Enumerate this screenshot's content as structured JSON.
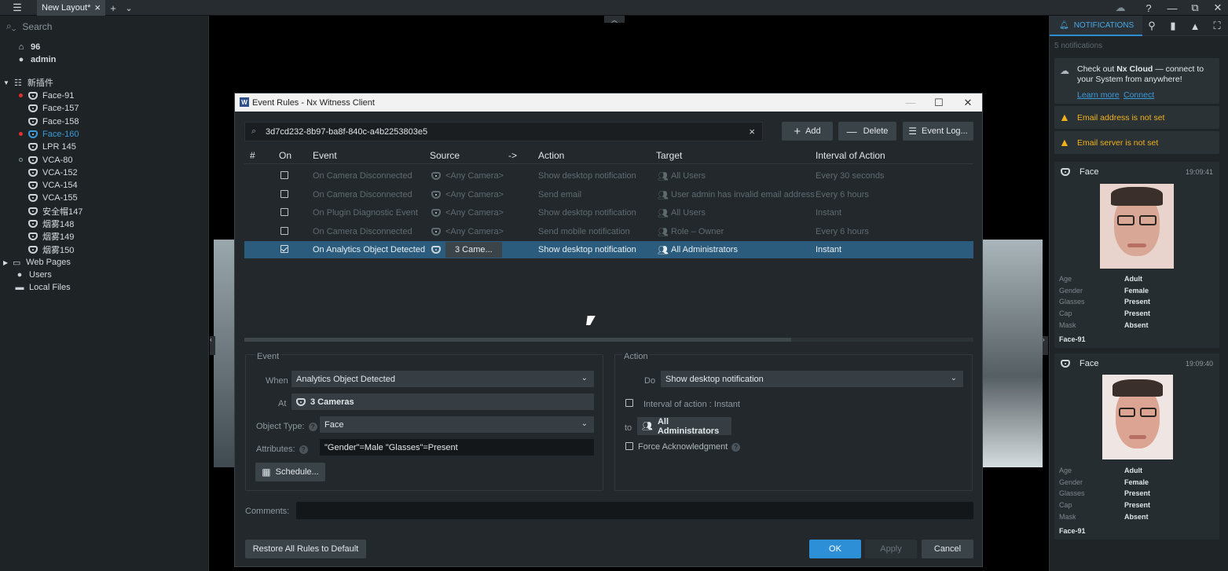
{
  "titlebar": {
    "tab_label": "New Layout*",
    "tab_close": "×",
    "add_tab": "+",
    "more": "⌄"
  },
  "window_controls": {
    "help": "?",
    "minimize": "—",
    "restore": "⧉",
    "close": "✕"
  },
  "left": {
    "search_placeholder": "Search",
    "server": "96",
    "user": "admin",
    "group": "新插件",
    "cameras": [
      {
        "name": "Face-91",
        "status": "red",
        "selected": false
      },
      {
        "name": "Face-157",
        "status": "none",
        "selected": false
      },
      {
        "name": "Face-158",
        "status": "none",
        "selected": false
      },
      {
        "name": "Face-160",
        "status": "red",
        "selected": true
      },
      {
        "name": "LPR 145",
        "status": "none",
        "selected": false
      },
      {
        "name": "VCA-80",
        "status": "hollow",
        "selected": false
      },
      {
        "name": "VCA-152",
        "status": "none",
        "selected": false
      },
      {
        "name": "VCA-154",
        "status": "none",
        "selected": false
      },
      {
        "name": "VCA-155",
        "status": "none",
        "selected": false
      },
      {
        "name": "安全帽147",
        "status": "none",
        "selected": false
      },
      {
        "name": "烟雾148",
        "status": "none",
        "selected": false
      },
      {
        "name": "烟雾149",
        "status": "none",
        "selected": false
      },
      {
        "name": "烟雾150",
        "status": "none",
        "selected": false
      }
    ],
    "web_pages": "Web Pages",
    "users": "Users",
    "local_files": "Local Files"
  },
  "right": {
    "tab_notifications": "NOTIFICATIONS",
    "count": "5 notifications",
    "cloud_text_1": "Check out ",
    "cloud_brand": "Nx Cloud",
    "cloud_text_2": " — connect to your System from anywhere!",
    "learn_more": "Learn more",
    "connect": "Connect",
    "warn_email_address": "Email address is not set",
    "warn_email_server": "Email server is not set",
    "cards": [
      {
        "title": "Face",
        "time": "19:09:41",
        "attrs": [
          [
            "Age",
            "Adult"
          ],
          [
            "Gender",
            "Female"
          ],
          [
            "Glasses",
            "Present"
          ],
          [
            "Cap",
            "Present"
          ],
          [
            "Mask",
            "Absent"
          ]
        ],
        "camera": "Face-91"
      },
      {
        "title": "Face",
        "time": "19:09:40",
        "attrs": [
          [
            "Age",
            "Adult"
          ],
          [
            "Gender",
            "Female"
          ],
          [
            "Glasses",
            "Present"
          ],
          [
            "Cap",
            "Present"
          ],
          [
            "Mask",
            "Absent"
          ]
        ],
        "camera": "Face-91"
      }
    ]
  },
  "dialog": {
    "title": "Event Rules - Nx Witness Client",
    "search_value": "3d7cd232-8b97-ba8f-840c-a4b2253803e5",
    "clear": "×",
    "add_label": "Add",
    "delete_label": "Delete",
    "event_log_label": "Event Log...",
    "columns": [
      "#",
      "On",
      "Event",
      "Source",
      "->",
      "Action",
      "Target",
      "Interval of Action"
    ],
    "rows": [
      {
        "event": "On Camera Disconnected",
        "source": "<Any Camera>",
        "action": "Show desktop notification",
        "target": "All Users",
        "interval": "Every 30 seconds",
        "selected": false
      },
      {
        "event": "On Camera Disconnected",
        "source": "<Any Camera>",
        "action": "Send email",
        "target": "User admin has invalid email address",
        "interval": "Every 6 hours",
        "selected": false
      },
      {
        "event": "On Plugin Diagnostic Event",
        "source": "<Any Camera>",
        "action": "Show desktop notification",
        "target": "All Users",
        "interval": "Instant",
        "selected": false
      },
      {
        "event": "On Camera Disconnected",
        "source": "<Any Camera>",
        "action": "Send mobile notification",
        "target": "Role – Owner",
        "interval": "Every 6 hours",
        "selected": false
      },
      {
        "event": "On Analytics Object Detected",
        "source": "3 Came...",
        "action": "Show desktop notification",
        "target": "All Administrators",
        "interval": "Instant",
        "selected": true
      }
    ],
    "event_section": "Event",
    "when_label": "When",
    "when_value": "Analytics Object Detected",
    "at_label": "At",
    "at_value": "3 Cameras",
    "object_type_label": "Object Type:",
    "object_type_value": "Face",
    "attributes_label": "Attributes:",
    "attributes_value": "\"Gender\"=Male \"Glasses\"=Present",
    "schedule_label": "Schedule...",
    "action_section": "Action",
    "do_label": "Do",
    "do_value": "Show desktop notification",
    "interval_label": "Interval of action :",
    "interval_value": "Instant",
    "to_label": "to",
    "to_value": "All Administrators",
    "force_ack_label": "Force Acknowledgment",
    "comments_label": "Comments:",
    "restore_label": "Restore All Rules to Default",
    "ok_label": "OK",
    "apply_label": "Apply",
    "cancel_label": "Cancel"
  }
}
